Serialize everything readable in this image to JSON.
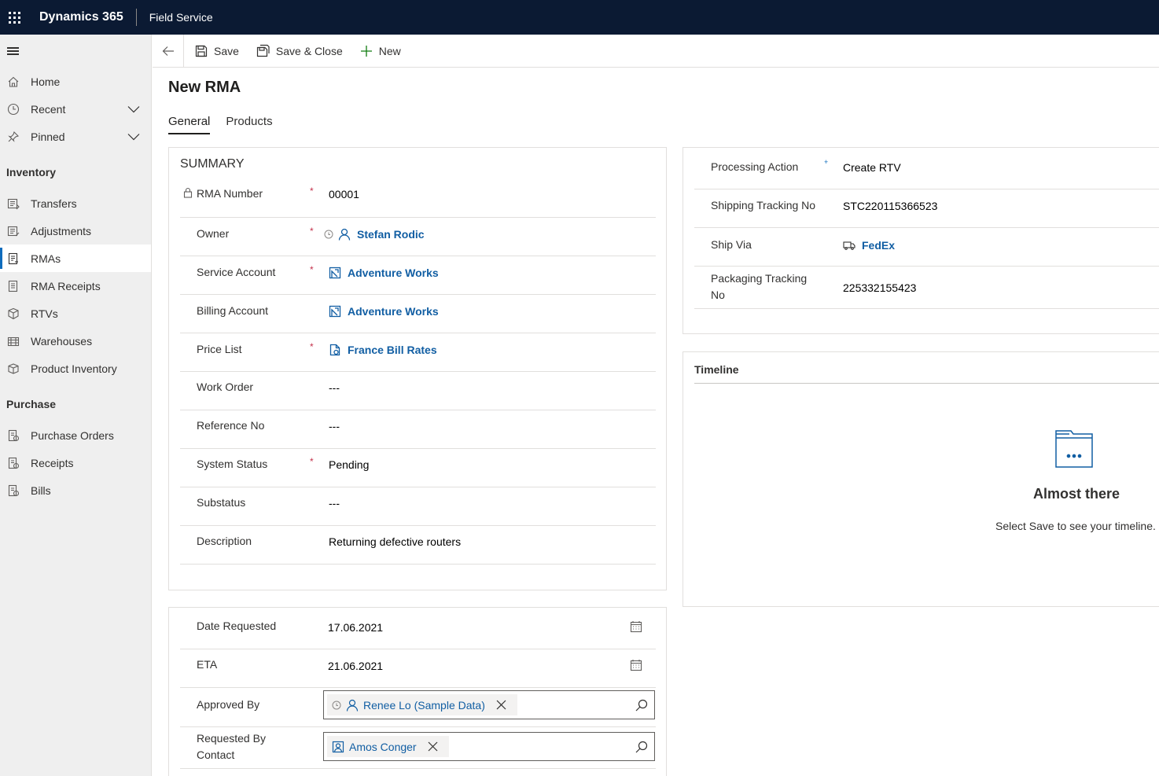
{
  "topbar": {
    "app_name": "Dynamics 365",
    "area_name": "Field Service"
  },
  "sidebar": {
    "top_items": [
      {
        "label": "Home",
        "icon": "home-icon"
      },
      {
        "label": "Recent",
        "icon": "clock-icon"
      },
      {
        "label": "Pinned",
        "icon": "pin-icon"
      }
    ],
    "groups": [
      {
        "title": "Inventory",
        "items": [
          {
            "label": "Transfers"
          },
          {
            "label": "Adjustments"
          },
          {
            "label": "RMAs",
            "selected": true
          },
          {
            "label": "RMA Receipts"
          },
          {
            "label": "RTVs"
          },
          {
            "label": "Warehouses"
          },
          {
            "label": "Product Inventory"
          }
        ]
      },
      {
        "title": "Purchase",
        "items": [
          {
            "label": "Purchase Orders"
          },
          {
            "label": "Receipts"
          },
          {
            "label": "Bills"
          }
        ]
      }
    ]
  },
  "commands": {
    "save": "Save",
    "save_close": "Save & Close",
    "new": "New"
  },
  "form": {
    "title": "New RMA",
    "tabs": [
      "General",
      "Products"
    ],
    "summary": {
      "title": "SUMMARY",
      "fields": {
        "rma_number": {
          "label": "RMA Number",
          "value": "00001"
        },
        "owner": {
          "label": "Owner",
          "value": "Stefan Rodic"
        },
        "service_account": {
          "label": "Service Account",
          "value": "Adventure Works"
        },
        "billing_account": {
          "label": "Billing Account",
          "value": "Adventure Works"
        },
        "price_list": {
          "label": "Price List",
          "value": "France Bill Rates"
        },
        "work_order": {
          "label": "Work Order",
          "value": "---"
        },
        "reference_no": {
          "label": "Reference No",
          "value": "---"
        },
        "system_status": {
          "label": "System Status",
          "value": "Pending"
        },
        "substatus": {
          "label": "Substatus",
          "value": "---"
        },
        "description": {
          "label": "Description",
          "value": "Returning defective routers"
        }
      }
    },
    "dates": {
      "date_requested": {
        "label": "Date Requested",
        "value": "17.06.2021"
      },
      "eta": {
        "label": "ETA",
        "value": "21.06.2021"
      },
      "approved_by": {
        "label": "Approved By",
        "value": "Renee Lo (Sample Data)"
      },
      "requested_by": {
        "label_line1": "Requested By",
        "label_line2": "Contact",
        "value": "Amos Conger"
      }
    },
    "shipping": {
      "processing_action": {
        "label": "Processing Action",
        "value": "Create RTV"
      },
      "shipping_tracking": {
        "label": "Shipping Tracking No",
        "value": "STC220115366523"
      },
      "ship_via": {
        "label": "Ship Via",
        "value": "FedEx"
      },
      "packaging_tracking": {
        "label_line1": "Packaging Tracking",
        "label_line2": "No",
        "value": "225332155423"
      }
    },
    "timeline": {
      "title": "Timeline",
      "empty_title": "Almost there",
      "empty_message": "Select Save to see your timeline."
    }
  },
  "colors": {
    "topbar": "#0b1a33",
    "link": "#115ea3",
    "required": "#c4314b",
    "sidebar_bg": "#efefef"
  }
}
